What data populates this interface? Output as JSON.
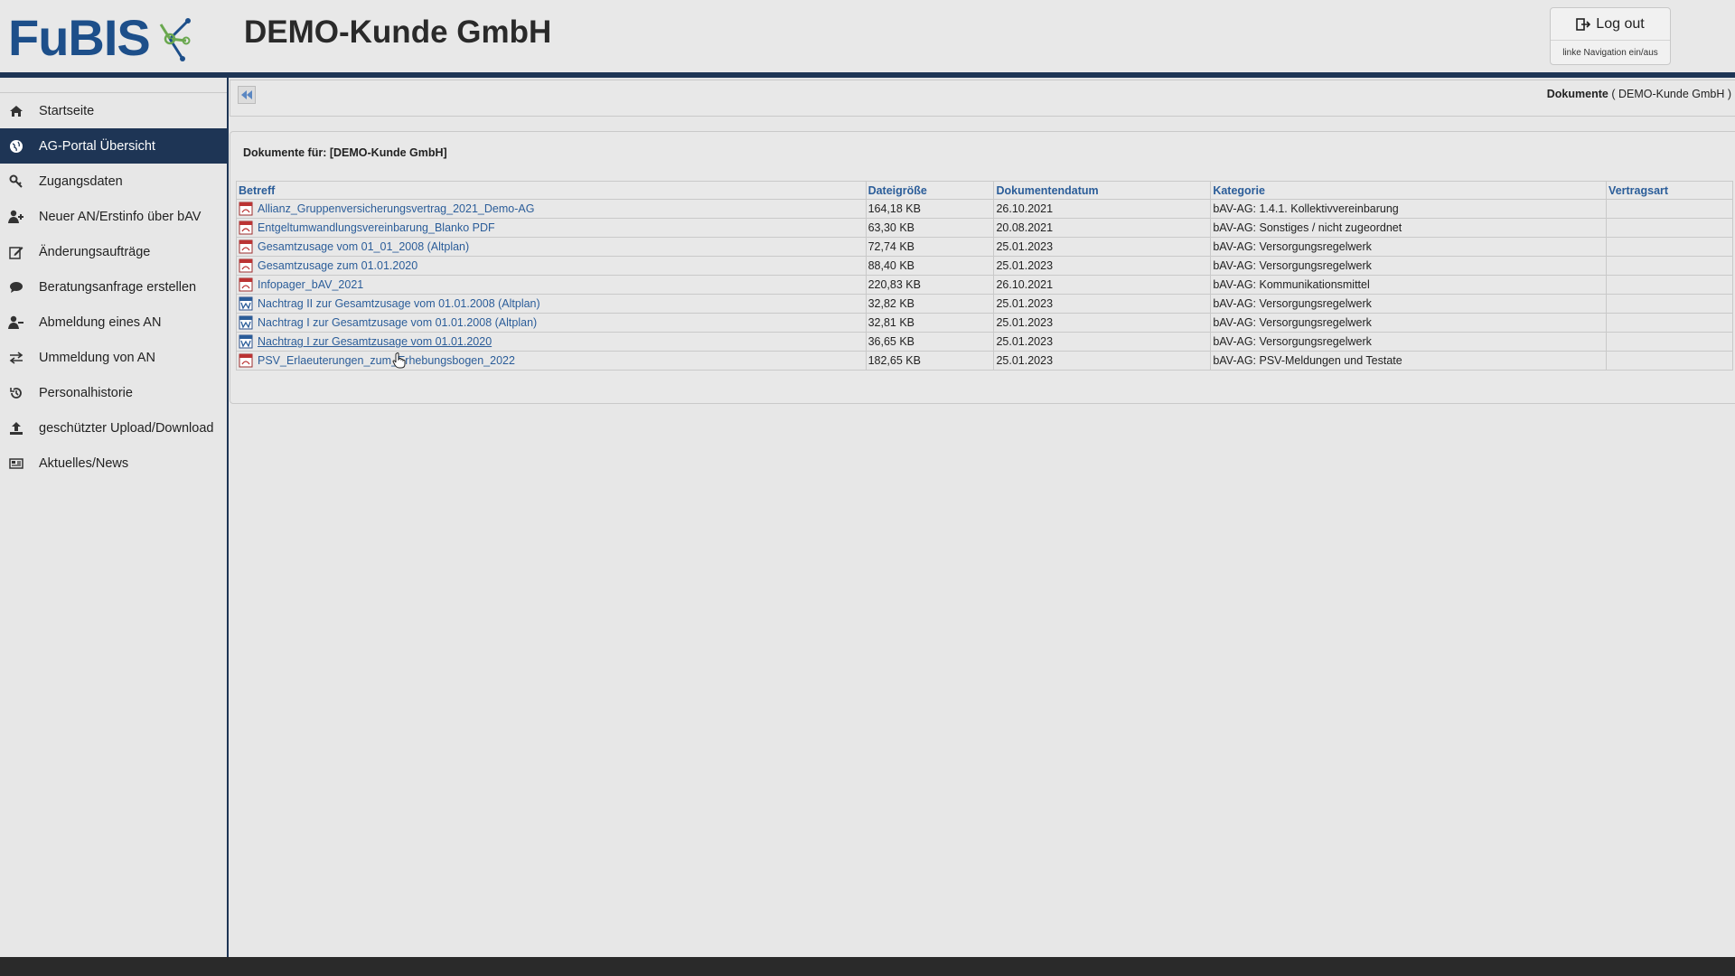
{
  "header": {
    "logo_text": "FuBIS",
    "company_title": "DEMO-Kunde GmbH",
    "logout_label": "Log out",
    "nav_toggle_label": "linke Navigation ein/aus"
  },
  "sidebar": {
    "items": [
      {
        "label": "Startseite",
        "icon": "home-icon"
      },
      {
        "label": "AG-Portal Übersicht",
        "icon": "globe-icon",
        "active": true
      },
      {
        "label": "Zugangsdaten",
        "icon": "key-icon"
      },
      {
        "label": "Neuer AN/Erstinfo über bAV",
        "icon": "user-plus-icon"
      },
      {
        "label": "Änderungsaufträge",
        "icon": "edit-icon"
      },
      {
        "label": "Beratungsanfrage erstellen",
        "icon": "chat-icon"
      },
      {
        "label": "Abmeldung eines AN",
        "icon": "user-minus-icon"
      },
      {
        "label": "Ummeldung von AN",
        "icon": "exchange-icon"
      },
      {
        "label": "Personalhistorie",
        "icon": "history-icon"
      },
      {
        "label": "geschützter Upload/Download",
        "icon": "upload-icon"
      },
      {
        "label": "Aktuelles/News",
        "icon": "news-icon"
      }
    ]
  },
  "breadcrumb": {
    "section": "Dokumente",
    "context": "( DEMO-Kunde GmbH )"
  },
  "documents": {
    "heading": "Dokumente für: [DEMO-Kunde GmbH]",
    "columns": [
      "Betreff",
      "Dateigröße",
      "Dokumentendatum",
      "Kategorie",
      "Vertragsart"
    ],
    "rows": [
      {
        "betreff": "Allianz_Gruppenversicherungsvertrag_2021_Demo-AG",
        "size": "164,18 KB",
        "date": "26.10.2021",
        "category": "bAV-AG: 1.4.1. Kollektivvereinbarung",
        "type": "",
        "filetype": "pdf"
      },
      {
        "betreff": "Entgeltumwandlungsvereinbarung_Blanko PDF",
        "size": "63,30 KB",
        "date": "20.08.2021",
        "category": "bAV-AG: Sonstiges / nicht zugeordnet",
        "type": "",
        "filetype": "pdf"
      },
      {
        "betreff": "Gesamtzusage vom 01_01_2008 (Altplan)",
        "size": "72,74 KB",
        "date": "25.01.2023",
        "category": "bAV-AG: Versorgungsregelwerk",
        "type": "",
        "filetype": "pdf"
      },
      {
        "betreff": "Gesamtzusage zum 01.01.2020",
        "size": "88,40 KB",
        "date": "25.01.2023",
        "category": "bAV-AG: Versorgungsregelwerk",
        "type": "",
        "filetype": "pdf"
      },
      {
        "betreff": "Infopager_bAV_2021",
        "size": "220,83 KB",
        "date": "26.10.2021",
        "category": "bAV-AG: Kommunikationsmittel",
        "type": "",
        "filetype": "pdf"
      },
      {
        "betreff": "Nachtrag II zur Gesamtzusage vom 01.01.2008 (Altplan)",
        "size": "32,82 KB",
        "date": "25.01.2023",
        "category": "bAV-AG: Versorgungsregelwerk",
        "type": "",
        "filetype": "doc"
      },
      {
        "betreff": "Nachtrag I zur Gesamtzusage vom 01.01.2008 (Altplan)",
        "size": "32,81 KB",
        "date": "25.01.2023",
        "category": "bAV-AG: Versorgungsregelwerk",
        "type": "",
        "filetype": "doc"
      },
      {
        "betreff": "Nachtrag I zur Gesamtzusage vom 01.01.2020",
        "size": "36,65 KB",
        "date": "25.01.2023",
        "category": "bAV-AG: Versorgungsregelwerk",
        "type": "",
        "filetype": "doc",
        "hovered": true
      },
      {
        "betreff": "PSV_Erlaeuterungen_zum_Erhebungsbogen_2022",
        "size": "182,65 KB",
        "date": "25.01.2023",
        "category": "bAV-AG: PSV-Meldungen und Testate",
        "type": "",
        "filetype": "pdf"
      }
    ]
  },
  "colors": {
    "brand_navy": "#1e3555",
    "link_blue": "#2b5d99",
    "logo_blue": "#1d4f8a",
    "logo_green": "#6aa84f"
  }
}
